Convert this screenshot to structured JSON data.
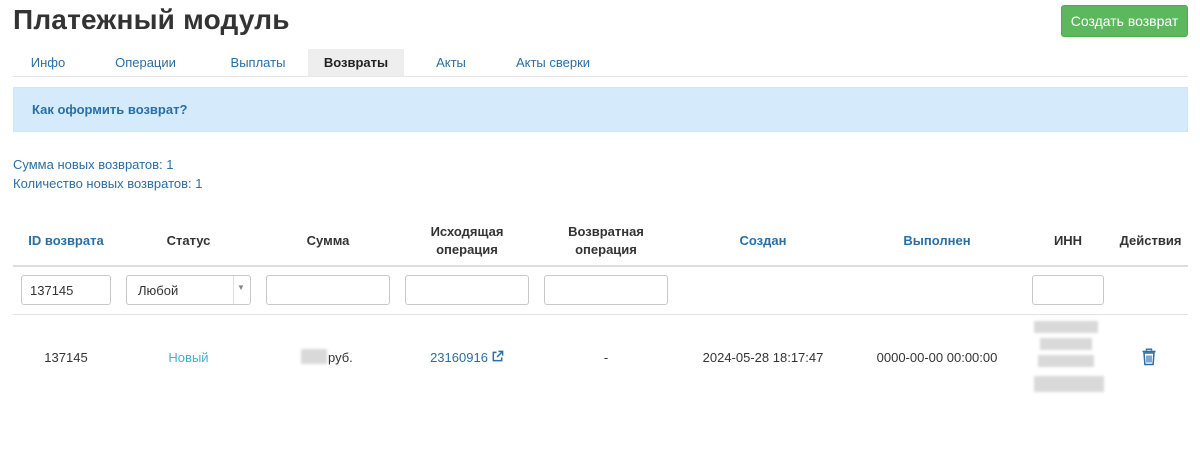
{
  "header": {
    "title": "Платежный модуль",
    "create_button": "Создать возврат"
  },
  "tabs": [
    {
      "label": "Инфо"
    },
    {
      "label": "Операции"
    },
    {
      "label": "Выплаты"
    },
    {
      "label": "Возвраты",
      "active": true
    },
    {
      "label": "Акты"
    },
    {
      "label": "Акты сверки"
    }
  ],
  "info": {
    "link": "Как оформить возврат?"
  },
  "summary": {
    "sum": "Сумма новых возвратов: 1",
    "count": "Количество новых возвратов: 1"
  },
  "table": {
    "headers": {
      "id": "ID возврата",
      "status": "Статус",
      "amount": "Сумма",
      "source_line1": "Исходящая",
      "source_line2": "операция",
      "return_line1": "Возвратная",
      "return_line2": "операция",
      "created": "Создан",
      "completed": "Выполнен",
      "inn": "ИНН",
      "actions": "Действия"
    },
    "filters": {
      "id_value": "137145",
      "status_value": "Любой",
      "amount_value": "",
      "source_value": "",
      "return_value": "",
      "inn_value": ""
    },
    "rows": [
      {
        "id": "137145",
        "status": "Новый",
        "amount_currency": "руб.",
        "source_operation": "23160916",
        "return_operation": "-",
        "created": "2024-05-28 18:17:47",
        "completed": "0000-00-00 00:00:00"
      }
    ]
  },
  "icons": {
    "external_link": "external-link-icon",
    "delete": "trash-icon",
    "dropdown": "caret-down-icon"
  },
  "colors": {
    "primary_link": "#2a6ea6",
    "success_button": "#5cb85c",
    "status_new": "#3bb5c9",
    "info_bg": "#d5ebfb"
  }
}
